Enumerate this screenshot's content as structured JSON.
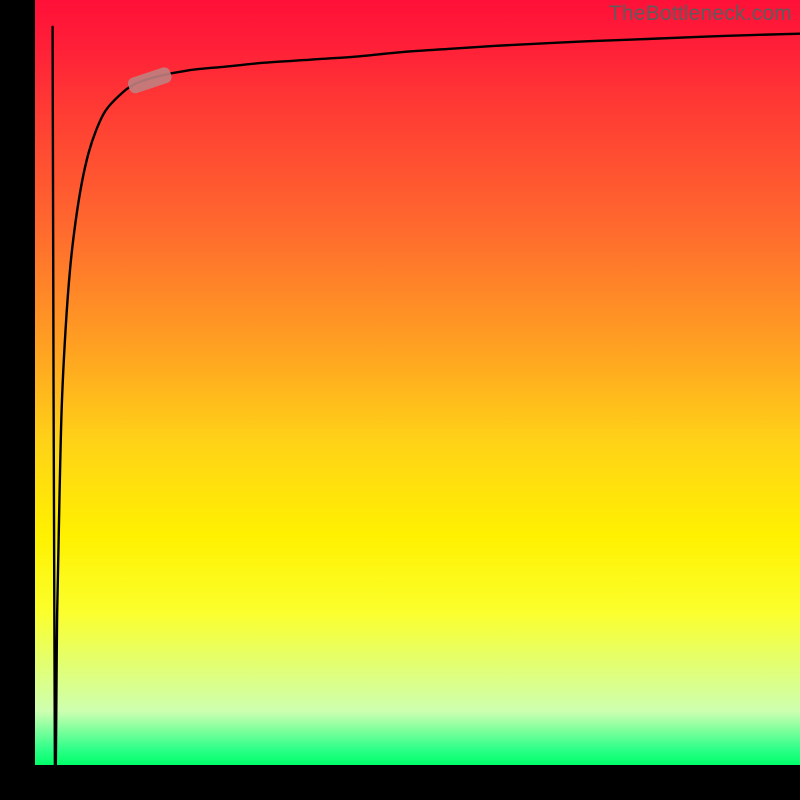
{
  "attribution": "TheBottleneck.com",
  "colors": {
    "axis": "#000000",
    "curve": "#000000",
    "marker": "#c08080",
    "gradient_top": "#ff1038",
    "gradient_bottom": "#00ff6a"
  },
  "chart_data": {
    "type": "line",
    "title": "",
    "xlabel": "",
    "ylabel": "",
    "xlim": [
      0,
      100
    ],
    "ylim": [
      0,
      100
    ],
    "grid": false,
    "legend": false,
    "x": [
      2.6,
      2.9,
      3.2,
      3.5,
      4,
      4.6,
      5.3,
      6.1,
      7,
      8,
      9.2,
      11,
      13,
      16,
      20,
      25,
      30,
      36,
      42,
      48,
      54,
      60,
      66,
      72,
      80,
      90,
      100
    ],
    "y": [
      0,
      20,
      35,
      47,
      57,
      65,
      71,
      76,
      80,
      83,
      85.5,
      87.5,
      89,
      90,
      90.8,
      91.3,
      91.8,
      92.2,
      92.6,
      93.2,
      93.6,
      94,
      94.3,
      94.6,
      94.9,
      95.3,
      95.6
    ],
    "marker": {
      "x": 15,
      "y": 89.5
    },
    "comment": "Curve shows bottleneck percentage vs relative component power; values estimated from pixel positions on an unlabeled gradient chart."
  }
}
